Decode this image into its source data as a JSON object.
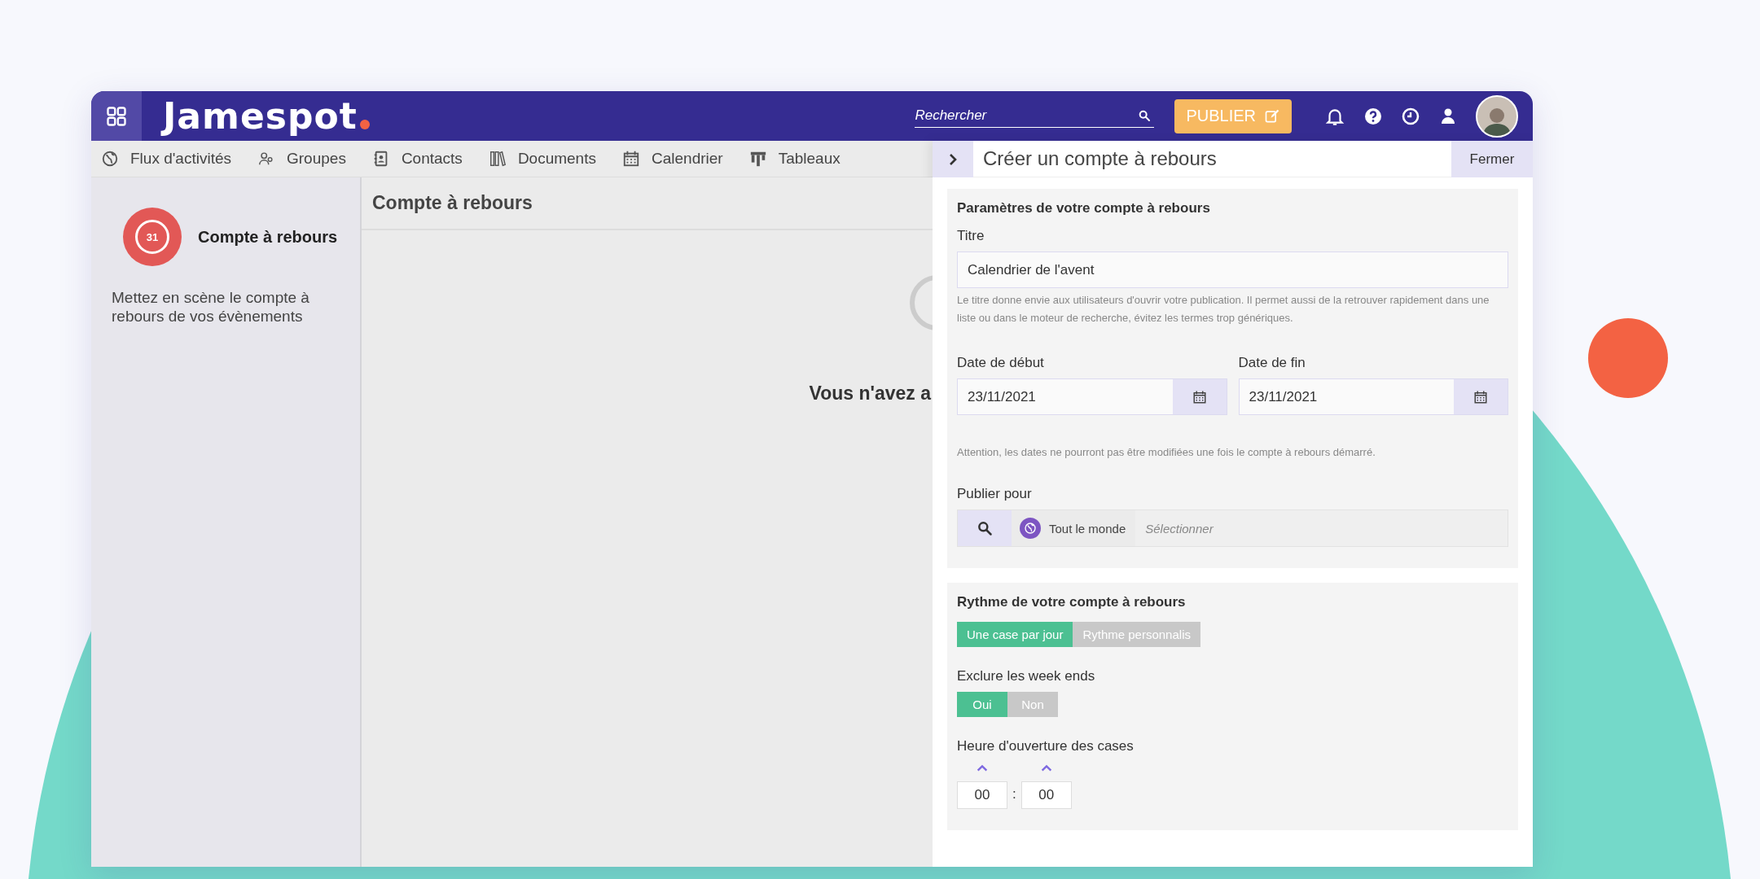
{
  "topbar": {
    "logo": "Jamespot",
    "search_placeholder": "Rechercher",
    "publish_button": "PUBLIER"
  },
  "nav": [
    {
      "label": "Flux d'activités",
      "kind": "globe"
    },
    {
      "label": "Groupes",
      "kind": "people"
    },
    {
      "label": "Contacts",
      "kind": "contacts"
    },
    {
      "label": "Documents",
      "kind": "books"
    },
    {
      "label": "Calendrier",
      "kind": "calendar"
    },
    {
      "label": "Tableaux",
      "kind": "board"
    }
  ],
  "sidebar": {
    "title": "Compte à rebours",
    "badge": "31",
    "description": "Mettez en scène le compte à rebours de vos évènements"
  },
  "main": {
    "title": "Compte à rebours",
    "empty_message": "Vous n'avez a"
  },
  "panel": {
    "title": "Créer un compte à rebours",
    "close_button": "Fermer",
    "settings": {
      "heading": "Paramètres de votre compte à rebours",
      "title_label": "Titre",
      "title_value": "Calendrier de l'avent",
      "title_hint": "Le titre donne envie aux utilisateurs d'ouvrir votre publication. Il permet aussi de la retrouver rapidement dans une liste ou dans le moteur de recherche, évitez les termes trop génériques.",
      "start_label": "Date de début",
      "start_value": "23/11/2021",
      "end_label": "Date de fin",
      "end_value": "23/11/2021",
      "dates_warning": "Attention, les dates ne pourront pas être modifiées une fois le compte à rebours démarré.",
      "audience_label": "Publier pour",
      "audience_tag": "Tout le monde",
      "audience_placeholder": "Sélectionner"
    },
    "rhythm": {
      "heading": "Rythme de votre compte à rebours",
      "modes": [
        {
          "label": "Une case par jour",
          "selected": true
        },
        {
          "label": "Rythme personnalis",
          "selected": false
        }
      ],
      "weekends_label": "Exclure les week ends",
      "weekends": [
        {
          "label": "Oui",
          "selected": true
        },
        {
          "label": "Non",
          "selected": false
        }
      ],
      "time_label": "Heure d'ouverture des cases",
      "hours": "00",
      "separator": ":",
      "minutes": "00"
    }
  }
}
